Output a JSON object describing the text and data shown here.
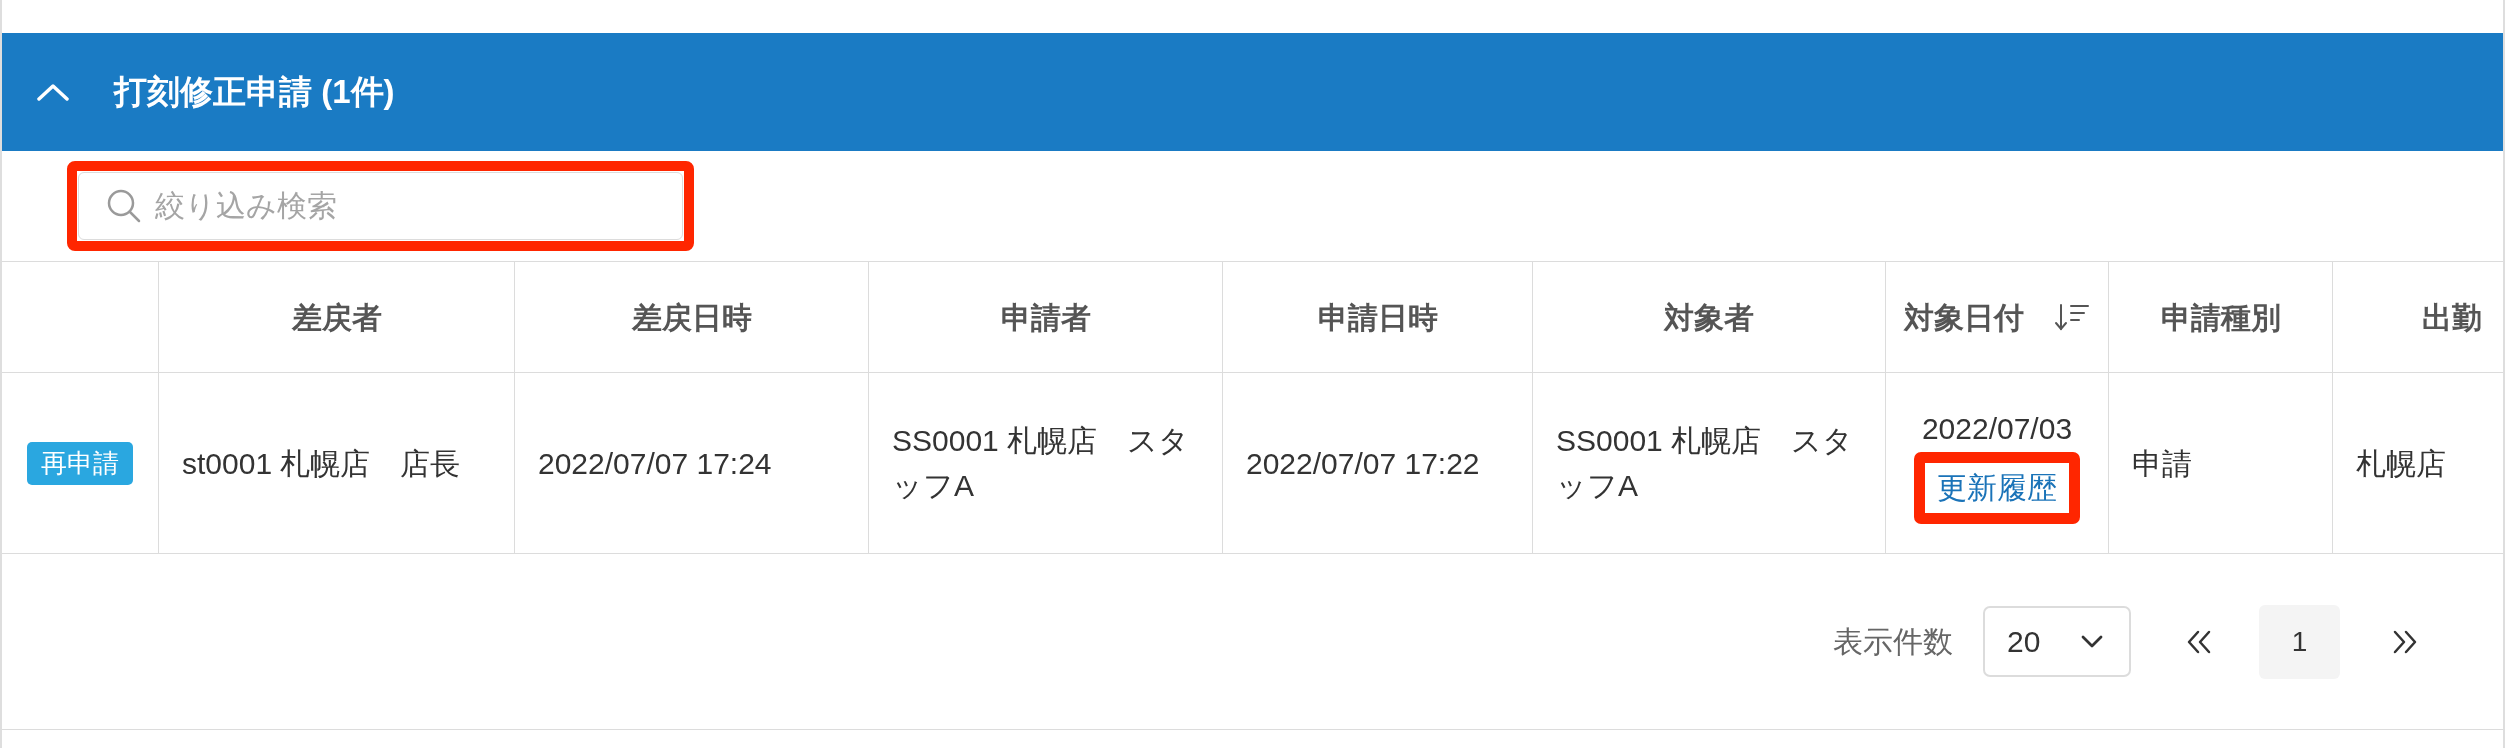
{
  "section": {
    "title": "打刻修正申請 (1件)",
    "expanded": true
  },
  "search": {
    "placeholder": "絞り込み検索",
    "highlighted": true
  },
  "table": {
    "columns": [
      {
        "label": "差戻者",
        "sortable": false
      },
      {
        "label": "差戻日時",
        "sortable": false
      },
      {
        "label": "申請者",
        "sortable": false
      },
      {
        "label": "申請日時",
        "sortable": false
      },
      {
        "label": "対象者",
        "sortable": false
      },
      {
        "label": "対象日付",
        "sortable": true
      },
      {
        "label": "申請種別",
        "sortable": false
      },
      {
        "label": "出勤",
        "sortable": false
      }
    ],
    "rows": [
      {
        "action": "再申請",
        "cells": [
          {
            "kind": "text",
            "text": "st0001 札幌店　店長"
          },
          {
            "kind": "text",
            "text": "2022/07/07 17:24"
          },
          {
            "kind": "text",
            "text": "SS0001 札幌店　スタッフA"
          },
          {
            "kind": "text",
            "text": "2022/07/07 17:22"
          },
          {
            "kind": "text",
            "text": "SS0001 札幌店　スタッフA"
          },
          {
            "kind": "date_link",
            "text": "2022/07/03",
            "link": "更新履歴",
            "highlighted": true
          },
          {
            "kind": "text",
            "text": "申請"
          },
          {
            "kind": "text",
            "text": "札幌店"
          }
        ]
      }
    ]
  },
  "pagination": {
    "label": "表示件数",
    "page_size": "20",
    "pages": [
      {
        "label": "1",
        "selected": true
      }
    ]
  }
}
